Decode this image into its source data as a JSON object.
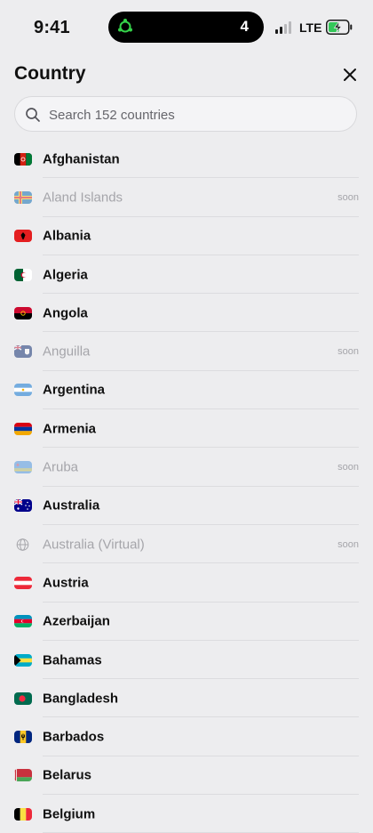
{
  "status_bar": {
    "time": "9:41",
    "island_count": "4",
    "network": "LTE",
    "icons": [
      "ubuntu-logo-icon",
      "signal-icon",
      "battery-charging-icon"
    ]
  },
  "header": {
    "title": "Country"
  },
  "search": {
    "placeholder": "Search 152 countries"
  },
  "countries": [
    {
      "name": "Afghanistan",
      "status": "",
      "flag": "af"
    },
    {
      "name": "Aland Islands",
      "status": "soon",
      "flag": "ax"
    },
    {
      "name": "Albania",
      "status": "",
      "flag": "al"
    },
    {
      "name": "Algeria",
      "status": "",
      "flag": "dz"
    },
    {
      "name": "Angola",
      "status": "",
      "flag": "ao"
    },
    {
      "name": "Anguilla",
      "status": "soon",
      "flag": "ai"
    },
    {
      "name": "Argentina",
      "status": "",
      "flag": "ar"
    },
    {
      "name": "Armenia",
      "status": "",
      "flag": "am"
    },
    {
      "name": "Aruba",
      "status": "soon",
      "flag": "aw"
    },
    {
      "name": "Australia",
      "status": "",
      "flag": "au"
    },
    {
      "name": "Australia (Virtual)",
      "status": "soon",
      "flag": "globe"
    },
    {
      "name": "Austria",
      "status": "",
      "flag": "at"
    },
    {
      "name": "Azerbaijan",
      "status": "",
      "flag": "az"
    },
    {
      "name": "Bahamas",
      "status": "",
      "flag": "bs"
    },
    {
      "name": "Bangladesh",
      "status": "",
      "flag": "bd"
    },
    {
      "name": "Barbados",
      "status": "",
      "flag": "bb"
    },
    {
      "name": "Belarus",
      "status": "",
      "flag": "by"
    },
    {
      "name": "Belgium",
      "status": "",
      "flag": "be"
    }
  ],
  "colors": {
    "background": "#ededef",
    "text": "#111111",
    "disabled_text": "#a5a5aa",
    "battery_charge": "#34c759",
    "divider": "#dcdcdf"
  }
}
